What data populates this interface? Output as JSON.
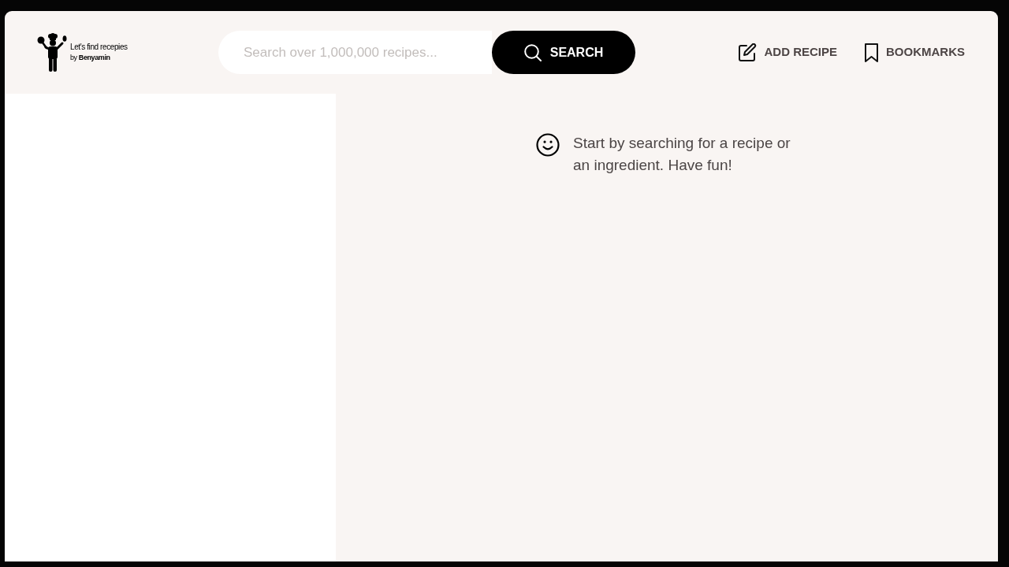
{
  "logo": {
    "tagline": "Let's find recepies",
    "byline": "by **Benyamin**"
  },
  "search": {
    "placeholder": "Search over 1,000,000 recipes...",
    "button": "SEARCH"
  },
  "nav": [
    {
      "kind": "add_recipe",
      "label": "ADD RECIPE"
    },
    {
      "kind": "bookmarks",
      "label": "BOOKMARKS"
    }
  ],
  "message": {
    "text": "Start by searching for a recipe or an ingredient. Have fun!"
  }
}
